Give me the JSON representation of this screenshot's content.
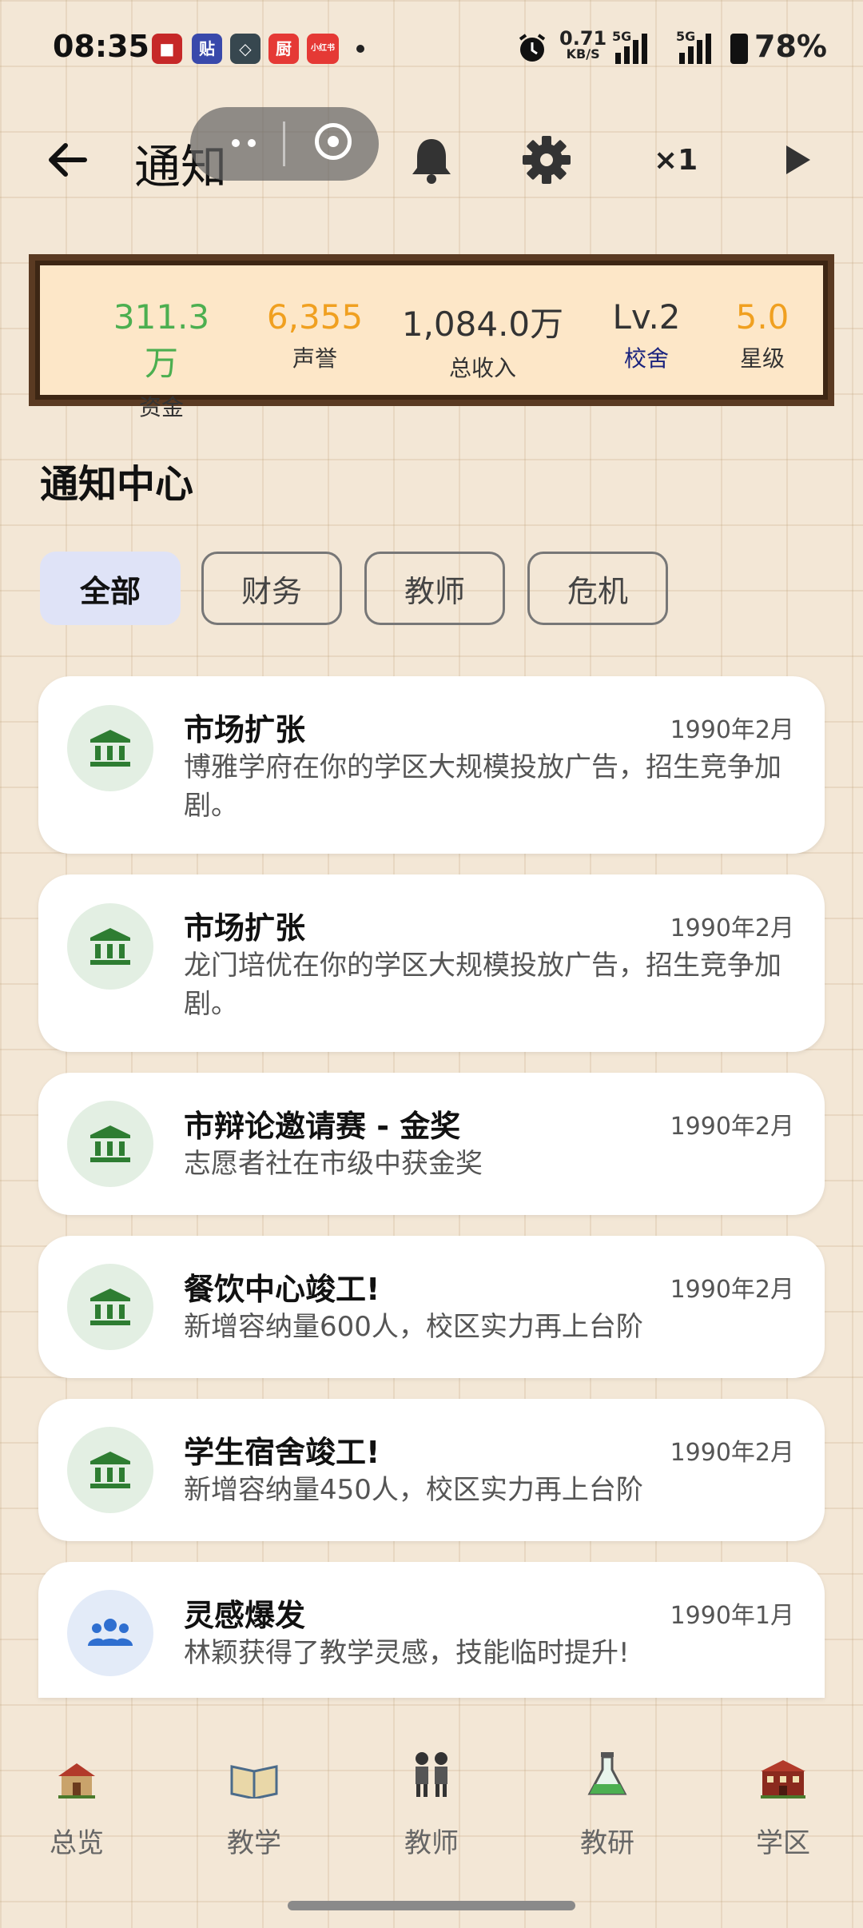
{
  "status_bar": {
    "time": "08:35",
    "app_icons": [
      "贴",
      "厨",
      "小红书"
    ],
    "net_speed_value": "0.71",
    "net_speed_unit": "KB/S",
    "signal_1": "5G",
    "signal_2": "5G",
    "battery": "78%"
  },
  "header": {
    "title": "通知",
    "speed": "×1",
    "icons": [
      "back-arrow-icon",
      "bell-icon",
      "gear-icon",
      "play-icon"
    ]
  },
  "stats": [
    {
      "value": "311.3万",
      "label": "资金",
      "value_color": "#4caf50",
      "label_color": "#333333"
    },
    {
      "value": "6,355",
      "label": "声誉",
      "value_color": "#f0a020",
      "label_color": "#333333"
    },
    {
      "value": "1,084.0万",
      "label": "总收入",
      "value_color": "#333333",
      "label_color": "#333333"
    },
    {
      "value": "Lv.2",
      "label": "校舍",
      "value_color": "#333333",
      "label_color": "#1a237e"
    },
    {
      "value": "5.0",
      "label": "星级",
      "value_color": "#f0a020",
      "label_color": "#333333"
    }
  ],
  "section_title": "通知中心",
  "filters": [
    {
      "label": "全部",
      "active": true
    },
    {
      "label": "财务",
      "active": false
    },
    {
      "label": "教师",
      "active": false
    },
    {
      "label": "危机",
      "active": false
    }
  ],
  "notifications": [
    {
      "title": "市场扩张",
      "date": "1990年2月",
      "body": "博雅学府在你的学区大规模投放广告，招生竞争加剧。",
      "icon": "bank-icon"
    },
    {
      "title": "市场扩张",
      "date": "1990年2月",
      "body": "龙门培优在你的学区大规模投放广告，招生竞争加剧。",
      "icon": "bank-icon"
    },
    {
      "title": "市辩论邀请赛 - 金奖",
      "date": "1990年2月",
      "body": "志愿者社在市级中获金奖",
      "icon": "bank-icon"
    },
    {
      "title": "餐饮中心竣工!",
      "date": "1990年2月",
      "body": "新增容纳量600人，校区实力再上台阶",
      "icon": "bank-icon"
    },
    {
      "title": "学生宿舍竣工!",
      "date": "1990年2月",
      "body": "新增容纳量450人，校区实力再上台阶",
      "icon": "bank-icon"
    },
    {
      "title": "灵感爆发",
      "date": "1990年1月",
      "body": "林颖获得了教学灵感，技能临时提升!",
      "icon": "people-icon"
    }
  ],
  "bottom_nav": [
    {
      "label": "总览",
      "icon": "school-house-icon"
    },
    {
      "label": "教学",
      "icon": "open-book-icon"
    },
    {
      "label": "教师",
      "icon": "teachers-icon"
    },
    {
      "label": "教研",
      "icon": "flask-icon"
    },
    {
      "label": "学区",
      "icon": "campus-building-icon"
    }
  ],
  "colors": {
    "bank_icon_bg": "#e3efe3",
    "bank_icon": "#2e7d32",
    "people_icon_bg": "#e3ebf8",
    "people_icon": "#2f6fd0",
    "active_chip": "#dfe3f7"
  }
}
